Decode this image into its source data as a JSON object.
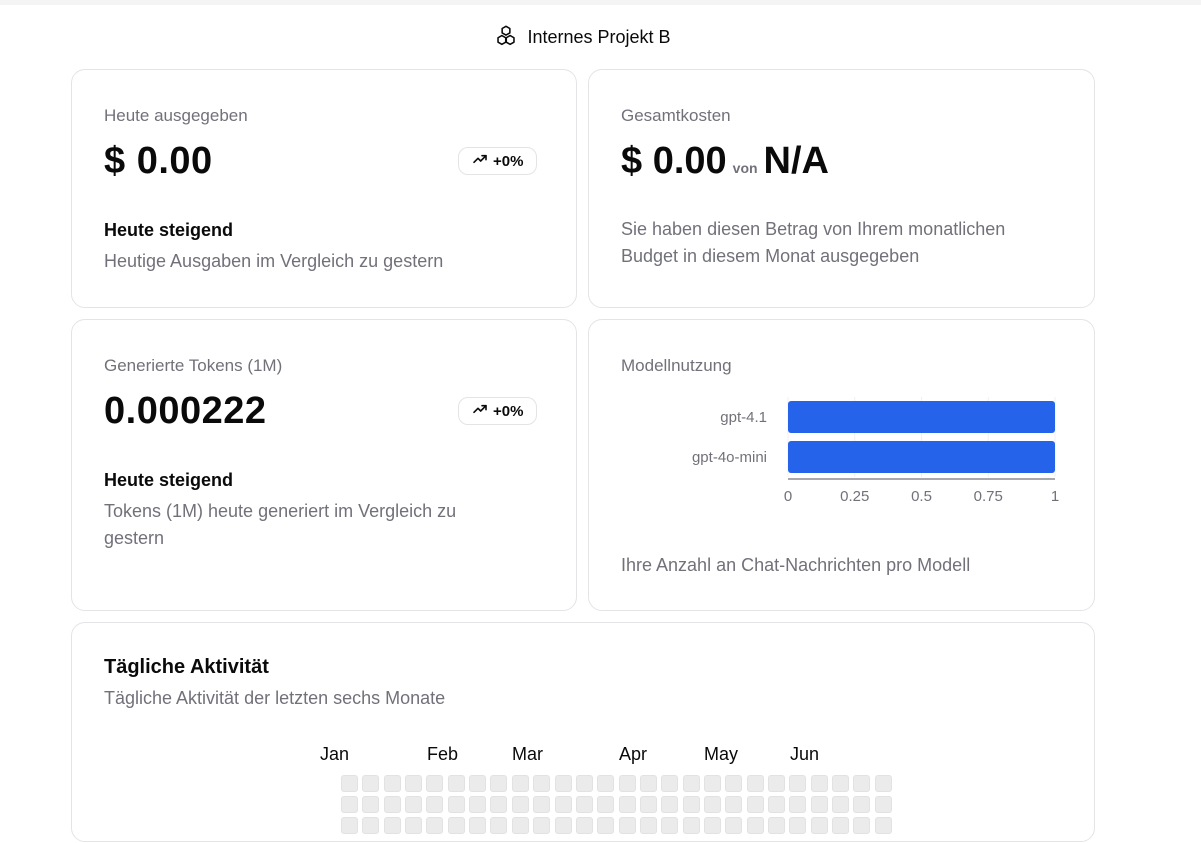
{
  "header": {
    "title": "Internes Projekt B",
    "icon": "cubes-icon"
  },
  "today_spent": {
    "label": "Heute ausgegeben",
    "value": "$ 0.00",
    "trend": "+0%",
    "sub_title": "Heute steigend",
    "sub_text": "Heutige Ausgaben im Vergleich zu gestern"
  },
  "total_costs": {
    "label": "Gesamtkosten",
    "value": "$ 0.00",
    "von": "von",
    "budget": "N/A",
    "sub_text_1": "Sie haben diesen Betrag von Ihrem monatlichen",
    "sub_text_2": "Budget in diesem Monat ausgegeben"
  },
  "tokens": {
    "label": "Generierte Tokens (1M)",
    "value": "0.000222",
    "trend": "+0%",
    "sub_title": "Heute steigend",
    "sub_text_1": "Tokens (1M) heute generiert im Vergleich zu",
    "sub_text_2": "gestern"
  },
  "model_usage": {
    "label": "Modellnutzung",
    "footer": "Ihre Anzahl an Chat-Nachrichten pro Modell"
  },
  "chart_data": {
    "type": "bar",
    "orientation": "horizontal",
    "categories": [
      "gpt-4.1",
      "gpt-4o-mini"
    ],
    "values": [
      1,
      1
    ],
    "xlim": [
      0,
      1
    ],
    "xticks": [
      "0",
      "0.25",
      "0.5",
      "0.75",
      "1"
    ],
    "color": "#2563eb",
    "title": "",
    "xlabel": "",
    "ylabel": ""
  },
  "activity": {
    "title": "Tägliche Aktivität",
    "subtitle": "Tägliche Aktivität der letzten sechs Monate",
    "months": [
      "Jan",
      "Feb",
      "Mar",
      "Apr",
      "May",
      "Jun"
    ],
    "cell_color": "#ebebeb"
  }
}
